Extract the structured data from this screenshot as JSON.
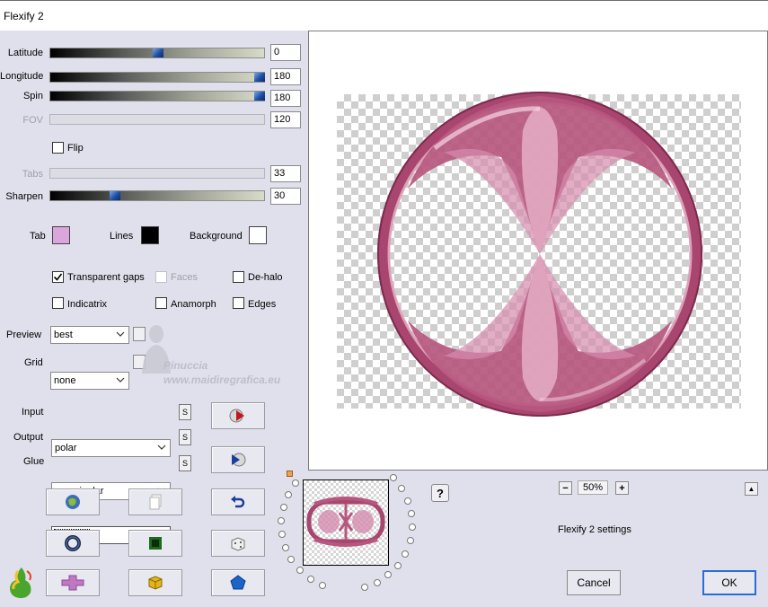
{
  "window": {
    "title": "Flexify 2"
  },
  "sliders": {
    "latitude": {
      "label": "Latitude",
      "value": "0",
      "position": 0.5,
      "enabled": true
    },
    "longitude": {
      "label": "Longitude",
      "value": "180",
      "position": 1.0,
      "enabled": true
    },
    "spin": {
      "label": "Spin",
      "value": "180",
      "position": 1.0,
      "enabled": true
    },
    "fov": {
      "label": "FOV",
      "value": "120",
      "enabled": false
    },
    "tabs": {
      "label": "Tabs",
      "value": "33",
      "enabled": false
    },
    "sharpen": {
      "label": "Sharpen",
      "value": "30",
      "position": 0.3,
      "enabled": true
    }
  },
  "flip": {
    "label": "Flip",
    "checked": false
  },
  "colors": {
    "tab": {
      "label": "Tab",
      "color": "#dba5de"
    },
    "lines": {
      "label": "Lines",
      "color": "#000000"
    },
    "background": {
      "label": "Background",
      "color": "#ffffff"
    }
  },
  "options": {
    "transparent_gaps": {
      "label": "Transparent gaps",
      "checked": true
    },
    "faces": {
      "label": "Faces",
      "checked": false,
      "enabled": false
    },
    "de_halo": {
      "label": "De-halo",
      "checked": false
    },
    "indicatrix": {
      "label": "Indicatrix",
      "checked": false
    },
    "anamorph": {
      "label": "Anamorph",
      "checked": false
    },
    "edges": {
      "label": "Edges",
      "checked": false
    }
  },
  "preview": {
    "label": "Preview",
    "value": "best"
  },
  "grid": {
    "label": "Grid",
    "value": "none"
  },
  "input": {
    "label": "Input",
    "value": "polar"
  },
  "output": {
    "label": "Output",
    "value": "magnipolar"
  },
  "glue": {
    "label": "Glue",
    "value": "normal"
  },
  "s_label": "S",
  "watermark": {
    "line1": "Pinuccia",
    "line2": "www.maidiregrafica.eu"
  },
  "help": {
    "label": "?"
  },
  "zoom": {
    "minus": "−",
    "value": "50%",
    "plus": "+",
    "collapse": "▲"
  },
  "settings_label": "Flexify 2 settings",
  "buttons": {
    "cancel": "Cancel",
    "ok": "OK"
  },
  "accent_colors": {
    "pink_dark": "#a3416a",
    "pink_light": "#e8b6cb",
    "ok_border": "#2a6bd8"
  },
  "icons": [
    "globe-icon",
    "page-icon",
    "undo-icon",
    "ring-icon",
    "green-square-icon",
    "dice-icon",
    "plus-shape-icon",
    "gold-cube-icon",
    "pentagon-icon",
    "arrow-red-icon",
    "arrow-blue-icon",
    "flaming-pear-logo"
  ]
}
